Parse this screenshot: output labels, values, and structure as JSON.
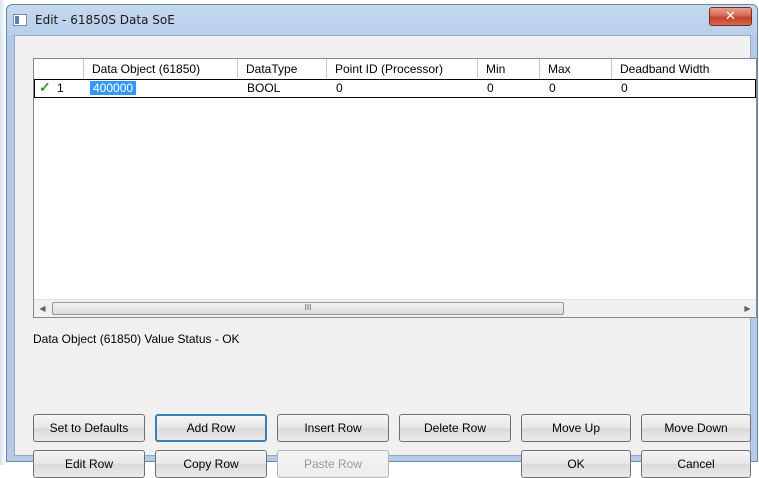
{
  "window": {
    "title": "Edit - 61850S Data SoE",
    "close_glyph": "✕"
  },
  "grid": {
    "columns": [
      "",
      "Data Object (61850)",
      "DataType",
      "Point ID (Processor)",
      "Min",
      "Max",
      "Deadband Width"
    ],
    "rows": [
      {
        "index": "1",
        "data_object": "400000",
        "data_type": "BOOL",
        "point_id": "0",
        "min": "0",
        "max": "0",
        "deadband": "0"
      }
    ],
    "scroll_left_glyph": "◀",
    "scroll_right_glyph": "▶",
    "scroll_grip": "III"
  },
  "status": {
    "text": "Data Object (61850) Value Status - OK"
  },
  "buttons": {
    "set_defaults": "Set to Defaults",
    "add_row": "Add Row",
    "insert_row": "Insert Row",
    "delete_row": "Delete Row",
    "move_up": "Move Up",
    "move_down": "Move Down",
    "edit_row": "Edit Row",
    "copy_row": "Copy Row",
    "paste_row": "Paste Row",
    "ok": "OK",
    "cancel": "Cancel"
  },
  "icons": {
    "row_status": "checkmark-icon",
    "window": "app-window-icon",
    "close": "close-icon"
  },
  "colors": {
    "selection": "#3399ff",
    "check": "#2a9a2a",
    "close_button": "#c2412a"
  }
}
